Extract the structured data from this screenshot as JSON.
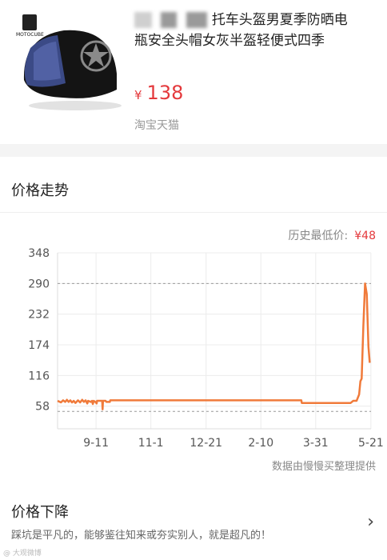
{
  "product": {
    "brand": "MOTOCUBE",
    "title_line1": "托车头盔男夏季防晒电",
    "title_line2": "瓶安全头帽女灰半盔轻便式四季",
    "currency": "¥",
    "price": "138",
    "shop": "淘宝天猫"
  },
  "trend": {
    "heading": "价格走势",
    "lowest_label": "历史最低价:",
    "lowest_value": "¥48",
    "source": "数据由慢慢买整理提供"
  },
  "drop": {
    "title": "价格下降",
    "text": "踩坑是平凡的，能够鉴往知来或夯实别人，就是超凡的！",
    "chevron_icon": "chevron-right-icon"
  },
  "watermark": "@ 大观微博",
  "colors": {
    "accent": "#e4393c",
    "line": "#f07a3a"
  },
  "chart_data": {
    "type": "line",
    "categories": [
      "9-11",
      "11-1",
      "12-21",
      "2-10",
      "3-31",
      "5-21"
    ],
    "yticks": [
      348,
      290,
      232,
      174,
      116,
      58
    ],
    "ylim": [
      0,
      348
    ],
    "reference_lines": [
      290,
      48
    ],
    "series": [
      {
        "values": [
          [
            0.0,
            68
          ],
          [
            0.8,
            65
          ],
          [
            1.3,
            69
          ],
          [
            1.8,
            66
          ],
          [
            2.2,
            70
          ],
          [
            2.6,
            66
          ],
          [
            3.0,
            69
          ],
          [
            3.4,
            65
          ],
          [
            3.8,
            68
          ],
          [
            4.2,
            64
          ],
          [
            4.8,
            69
          ],
          [
            5.3,
            65
          ],
          [
            5.8,
            70
          ],
          [
            6.2,
            66
          ],
          [
            6.6,
            69
          ],
          [
            7.0,
            63
          ],
          [
            7.2,
            68
          ],
          [
            7.8,
            66
          ],
          [
            8.1,
            68
          ],
          [
            8.3,
            62
          ],
          [
            8.5,
            68
          ],
          [
            8.9,
            66
          ],
          [
            9.2,
            63
          ],
          [
            9.3,
            68
          ],
          [
            10.5,
            68
          ],
          [
            10.6,
            52
          ],
          [
            10.7,
            68
          ],
          [
            11.3,
            68
          ],
          [
            11.5,
            66
          ],
          [
            12.3,
            66
          ],
          [
            12.4,
            69
          ],
          [
            57.4,
            69
          ],
          [
            57.5,
            64
          ],
          [
            69.0,
            64
          ],
          [
            69.6,
            68
          ],
          [
            70.4,
            68
          ],
          [
            71.0,
            80
          ],
          [
            71.3,
            105
          ],
          [
            71.6,
            110
          ],
          [
            72.0,
            210
          ],
          [
            72.4,
            290
          ],
          [
            72.8,
            270
          ],
          [
            73.2,
            170
          ],
          [
            73.5,
            140
          ]
        ]
      }
    ]
  }
}
